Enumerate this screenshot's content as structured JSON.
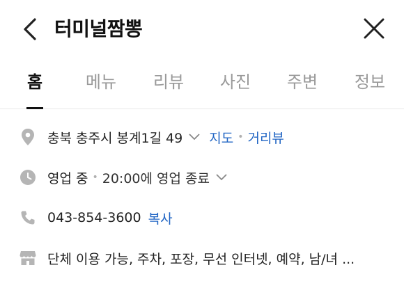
{
  "header": {
    "title": "터미널짬뽕"
  },
  "tabs": [
    {
      "label": "홈",
      "active": true
    },
    {
      "label": "메뉴",
      "active": false
    },
    {
      "label": "리뷰",
      "active": false
    },
    {
      "label": "사진",
      "active": false
    },
    {
      "label": "주변",
      "active": false
    },
    {
      "label": "정보",
      "active": false
    }
  ],
  "info": {
    "address": {
      "text": "충북 충주시 봉계1길 49",
      "map_link": "지도",
      "street_view_link": "거리뷰",
      "icon": "location-pin-icon"
    },
    "hours": {
      "status": "영업 중",
      "detail": "20:00에 영업 종료",
      "icon": "clock-icon"
    },
    "phone": {
      "number": "043-854-3600",
      "copy_label": "복사",
      "icon": "phone-icon"
    },
    "amenities": {
      "text": "단체 이용 가능, 주차, 포장, 무선 인터넷, 예약, 남/녀 ...",
      "icon": "store-icon"
    }
  },
  "colors": {
    "link": "#2266c4",
    "icon": "#b5b5b5",
    "inactive_tab": "#9a9a9a"
  }
}
